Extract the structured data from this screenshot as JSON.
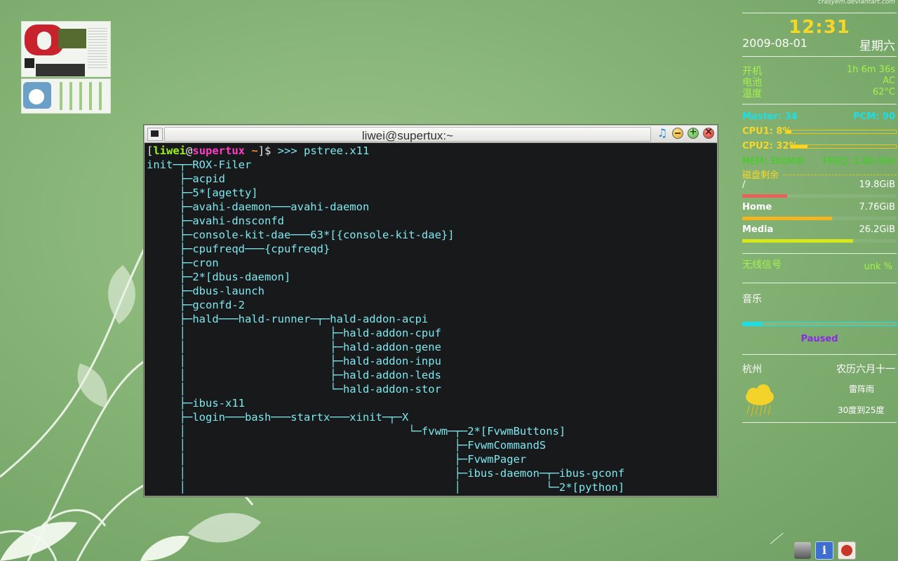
{
  "terminal": {
    "title": "liwei@supertux:~",
    "prompt": {
      "open_bracket": "[",
      "user": "liwei",
      "at": "@",
      "host": "supertux",
      "dir": " ~",
      "close": "]$ ",
      "arrows": ">>> ",
      "command": "pstree.x11"
    },
    "tree_lines": [
      "init─┬─ROX-Filer",
      "     ├─acpid",
      "     ├─5*[agetty]",
      "     ├─avahi-daemon───avahi-daemon",
      "     ├─avahi-dnsconfd",
      "     ├─console-kit-dae───63*[{console-kit-dae}]",
      "     ├─cpufreqd───{cpufreqd}",
      "     ├─cron",
      "     ├─2*[dbus-daemon]",
      "     ├─dbus-launch",
      "     ├─gconfd-2",
      "     ├─hald───hald-runner─┬─hald-addon-acpi",
      "     │                      ├─hald-addon-cpuf",
      "     │                      ├─hald-addon-gene",
      "     │                      ├─hald-addon-inpu",
      "     │                      ├─hald-addon-leds",
      "     │                      └─hald-addon-stor",
      "     ├─ibus-x11",
      "     ├─login───bash───startx───xinit─┬─X",
      "     │                                  └─fvwm─┬─2*[FvwmButtons]",
      "     │                                         ├─FvwmCommandS",
      "     │                                         ├─FvwmPager",
      "     │                                         ├─ibus-daemon─┬─ibus-gconf",
      "     │                                         │             └─2*[python]"
    ]
  },
  "conky": {
    "credit": "crasyem.deviantart.com",
    "time": "12:31",
    "date": "2009-08-01",
    "weekday": "星期六",
    "uptime_label": "开机",
    "uptime_value": "1h 6m 36s",
    "battery_label": "电池",
    "battery_value": "AC",
    "temp_label": "温度",
    "temp_value": "62°C",
    "master_label": "Master: 34",
    "pcm_label": "PCM: 90",
    "cpu1_label": "CPU1: 8%",
    "cpu1_pct": 0.05,
    "cpu2_label": "CPU2: 32%",
    "cpu2_pct": 0.16,
    "mem_label": "MEM: 300MiB",
    "freq_label": "FREQ: 1.80 GHz",
    "disk_title": "磁盘剩余",
    "disks": [
      {
        "name": "/",
        "free": "19.8GiB",
        "used_pct": 0.29,
        "color": "#e8615a"
      },
      {
        "name": "Home",
        "free": "7.76GiB",
        "used_pct": 0.58,
        "color": "#f6b41e"
      },
      {
        "name": "Media",
        "free": "26.2GiB",
        "used_pct": 0.72,
        "color": "#d7e61a"
      }
    ],
    "wifi_label": "无线信号",
    "wifi_value": "unk  %",
    "music_label": "音乐",
    "music_progress": 0.13,
    "music_status": "Paused",
    "city": "杭州",
    "lunar": "农历六月十一",
    "weather": "雷阵雨",
    "temp_range": "30度到25度"
  },
  "colors": {
    "yellow": "#f7d628",
    "green_text": "#a6f04a",
    "cyan": "#19e0e8",
    "purple": "#8a2be2",
    "mem_green": "#39d31a"
  }
}
